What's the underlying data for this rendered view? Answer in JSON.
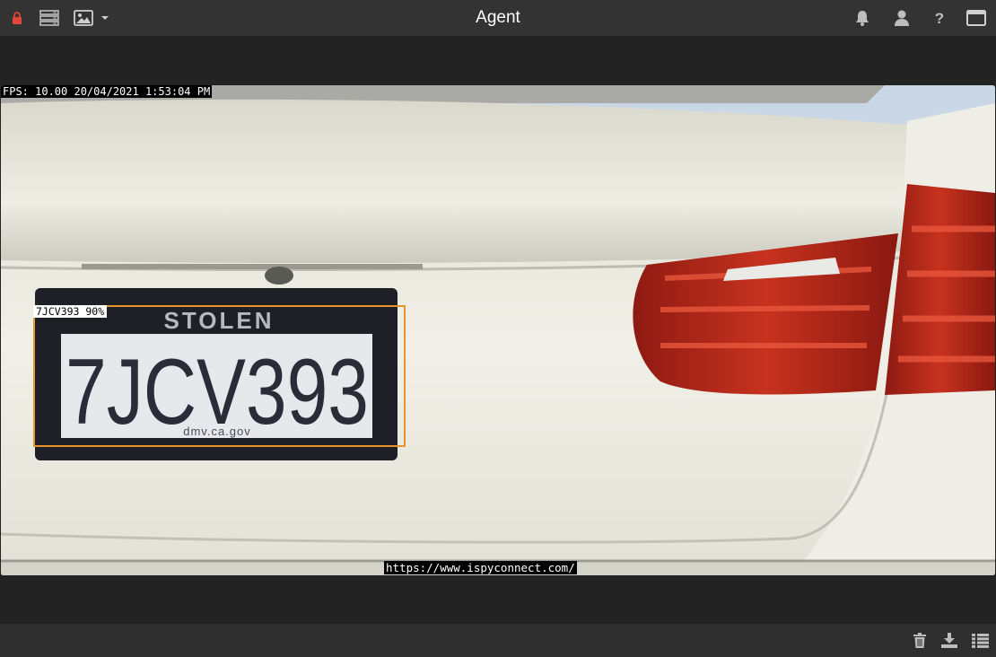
{
  "app": {
    "title": "Agent"
  },
  "toolbar": {
    "lock_icon": "lock-icon",
    "server_icon": "server-icon",
    "image_icon": "image-icon",
    "dropdown_icon": "caret-down-icon",
    "notifications_icon": "bell-icon",
    "user_icon": "user-icon",
    "help_icon": "question-icon",
    "window_icon": "window-icon"
  },
  "camera": {
    "overlay_top": "FPS: 10.00 20/04/2021 1:53:04 PM",
    "overlay_bottom": "https://www.ispyconnect.com/",
    "detection": {
      "label": "7JCV393 90%",
      "color": "#e8952b"
    },
    "plate": {
      "banner": "STOLEN",
      "number": "7JCV393",
      "footer": "dmv.ca.gov"
    }
  },
  "footer": {
    "delete_icon": "trash-icon",
    "download_icon": "download-icon",
    "list_icon": "list-icon"
  },
  "colors": {
    "toolbar_bg": "#333333",
    "page_bg": "#232323",
    "accent_lock": "#e0463a",
    "detection": "#e8952b"
  }
}
